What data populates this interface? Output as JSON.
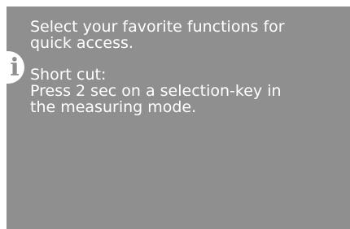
{
  "info_panel": {
    "icon": "info-icon",
    "colors": {
      "background": "#8f8f8f",
      "text": "#ffffff"
    },
    "paragraph1": {
      "line1": "Select your favorite functions for",
      "line2": "quick access."
    },
    "paragraph2": {
      "line1": "Short cut:",
      "line2": "Press 2 sec on a selection-key in",
      "line3": "the measuring mode."
    }
  }
}
